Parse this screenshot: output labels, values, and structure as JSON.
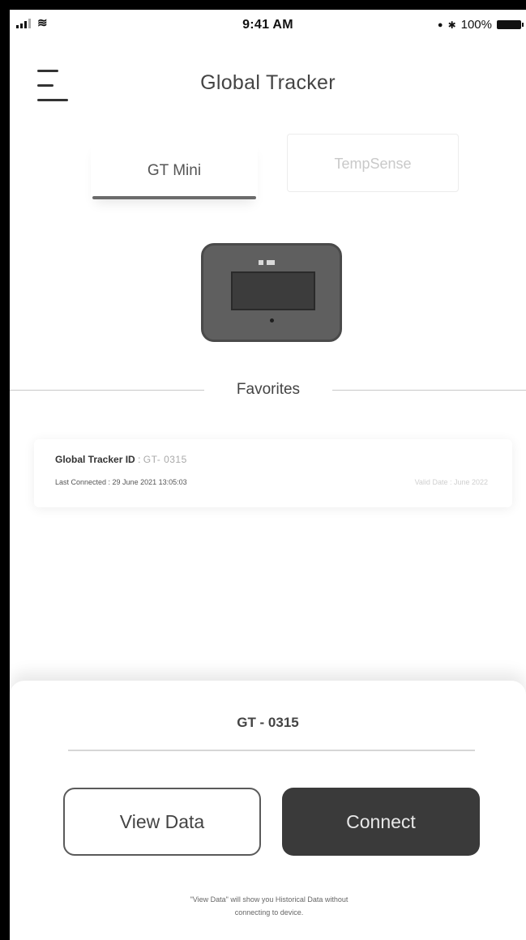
{
  "status_bar": {
    "time": "9:41 AM",
    "battery": "100%",
    "wifi_glyph": "≋",
    "alarm_glyph": "●",
    "bluetooth_glyph": "✱"
  },
  "header": {
    "title": "Global Tracker"
  },
  "tabs": [
    {
      "label": "GT Mini",
      "active": true
    },
    {
      "label": "TempSense",
      "active": false
    }
  ],
  "favorites": {
    "title": "Favorites",
    "items": [
      {
        "id_label": "Global Tracker ID",
        "id_separator": ":",
        "id_value": "GT- 0315",
        "last_connected": "Last Connected : 29 June 2021   13:05:03",
        "valid_date": "Valid Date : June 2022"
      }
    ]
  },
  "sheet": {
    "title": "GT - 0315",
    "view_data_label": "View Data",
    "connect_label": "Connect",
    "note_line1": "\"View Data\" will show you Historical Data without",
    "note_line2": "connecting to device."
  },
  "colors": {
    "connect_bg": "#3a3a3a",
    "tab_underline": "#6b6b6b",
    "device_body": "#5f5f5f"
  }
}
